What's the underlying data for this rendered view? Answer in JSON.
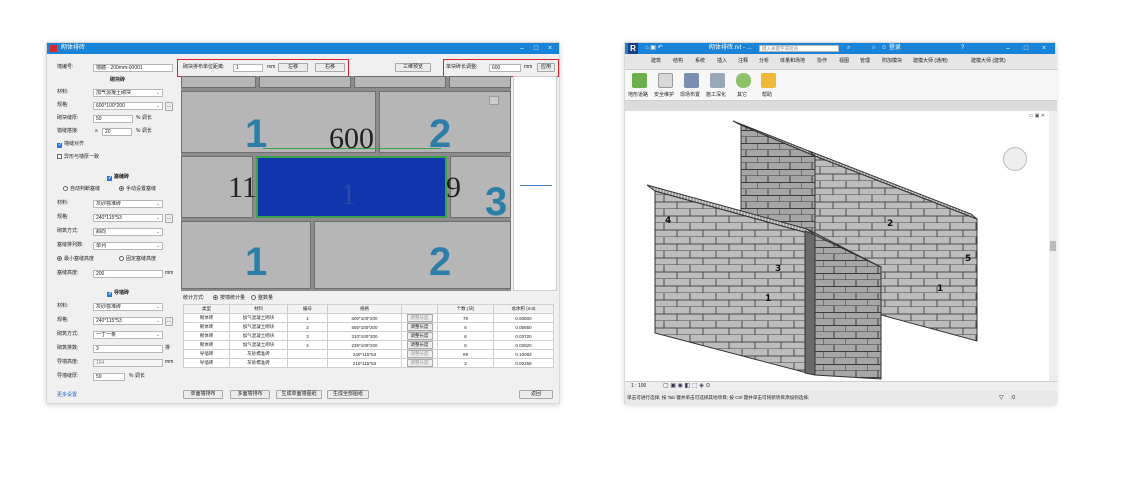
{
  "left": {
    "title": "砌体排砖",
    "wall_name_label": "墙编号:",
    "wall_name": "墙體 - 200mm-00001",
    "sections": {
      "block": "砌块砖",
      "top": "塞缝砖",
      "bottom": "导墙砖"
    },
    "material_label": "材料:",
    "spec_label": "规格:",
    "mortar_label": "砌块缝厚:",
    "mortar_value": "50",
    "mortar_unit": "% 调长",
    "spacing_label": "错缝搭接:",
    "spacing_prefix": "≥",
    "spacing_value": "20",
    "spacing_unit": "% 调长",
    "check_seam": "墙缝对齐",
    "check_same": "异形与墙厚一致",
    "block_material": "加气混凝土砌块",
    "block_spec": "600*100*200",
    "auto_label": "自动判断塞缝",
    "manual_label": "手动设置塞缝",
    "top_material": "灰砂標准砖",
    "top_spec": "240*115*53",
    "arr_label": "砌筑方式:",
    "arr_value": "斜向",
    "angle_label": "塞缝排列数:",
    "angle_value": "单列",
    "min_height_label": "最小塞缝高度",
    "fixed_height_label": "固定塞缝高度",
    "height_label": "塞缝高度:",
    "height_value": "200",
    "unit_mm": "mm",
    "bottom_material": "灰砂標准砖",
    "bottom_spec": "240*115*53",
    "bottom_arr": "一丁一条",
    "rows_label": "砌筑排数:",
    "rows_value": "3",
    "rows_unit": "排",
    "base_height_label": "导墙高度:",
    "base_height_value": "164",
    "gap_label": "导墙缝厚:",
    "gap_value": "50",
    "link_more": "更多设置",
    "toolbar": {
      "offset_label": "砌块排布单位距离:",
      "offset_value": "1",
      "unit": "mm",
      "left_btn": "左移",
      "right_btn": "右移",
      "view3d_btn": "三维预览",
      "adj_label": "单块砖长调整:",
      "adj_value": "600",
      "apply_btn": "应用"
    },
    "canvas": {
      "n1a": "1",
      "n600": "600",
      "n2a": "2",
      "n11": "11",
      "n1c": "1",
      "n9": "9",
      "n3": "3",
      "n1b": "1",
      "n2b": "2"
    },
    "stats": {
      "label": "统计方式:",
      "opt1": "按墙统计量",
      "opt2": "整数量"
    },
    "table": {
      "headers": [
        "类型",
        "材料",
        "编号",
        "规格",
        "",
        "个数 (块)",
        "总体积 (m3)"
      ],
      "rows": [
        [
          "砌体砖",
          "加气混凝土砌块",
          "1",
          "600*100*200",
          "调整长度",
          "78",
          "0.93600"
        ],
        [
          "砌体砖",
          "加气混凝土砌块",
          "2",
          "555*100*200",
          "调整长度",
          "6",
          "0.06660"
        ],
        [
          "砌体砖",
          "加气混凝土砌块",
          "3",
          "310*100*200",
          "调整长度",
          "6",
          "0.03720"
        ],
        [
          "砌体砖",
          "加气混凝土砌块",
          "4",
          "235*100*200",
          "调整长度",
          "6",
          "0.02820"
        ],
        [
          "导墙砖",
          "灰砂標准砖",
          "",
          "240*115*53",
          "调整长度",
          "69",
          "0.10093"
        ],
        [
          "导墙砖",
          "灰砂標准砖",
          "",
          "210*115*53",
          "调整长度",
          "2",
          "0.00256"
        ]
      ]
    },
    "bottom_buttons": [
      "单面墙排布",
      "多面墙排布",
      "生成单面墙图纸",
      "生成全部图纸"
    ],
    "return_btn": "返回"
  },
  "right": {
    "title": "砌体排砖.rvt - ...",
    "search_placeholder": "键入关键字或短语",
    "login": "登录",
    "menu": [
      "建筑",
      "结构",
      "系统",
      "插入",
      "注释",
      "分析",
      "体量和场地",
      "协作",
      "视图",
      "管理",
      "附加模块",
      "建模大师 (通用)",
      "建模大师 (建筑)"
    ],
    "ribbon": [
      "地形道路",
      "安全维护",
      "现场布置",
      "施工深化",
      "其它",
      "帮助"
    ],
    "scale": "1 : 100",
    "status": "单击可进行选择; 按 Tab 键并单击可选择其他项目; 按 Ctrl 键并单击可将新项目添加到选择;",
    "status_right": ":0"
  }
}
